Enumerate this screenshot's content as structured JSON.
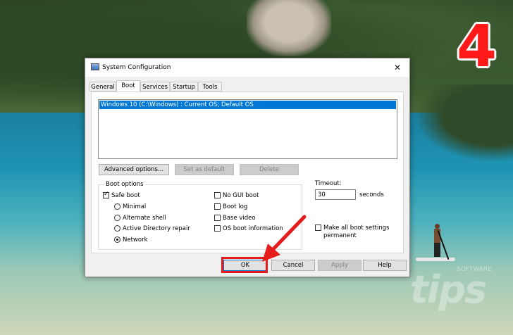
{
  "dialog": {
    "title": "System Configuration",
    "close_glyph": "✕",
    "tabs": [
      {
        "label": "General"
      },
      {
        "label": "Boot"
      },
      {
        "label": "Services"
      },
      {
        "label": "Startup"
      },
      {
        "label": "Tools"
      }
    ],
    "active_tab": "Boot",
    "os_entries": [
      "Windows 10 (C:\\Windows) : Current OS; Default OS"
    ],
    "buttons": {
      "advanced": "Advanced options...",
      "set_default": "Set as default",
      "delete": "Delete"
    },
    "boot_options": {
      "label": "Boot options",
      "safe_boot": {
        "label": "Safe boot",
        "checked": true
      },
      "minimal": {
        "label": "Minimal",
        "selected": false
      },
      "alternate_shell": {
        "label": "Alternate shell",
        "selected": false
      },
      "ad_repair": {
        "label": "Active Directory repair",
        "selected": false
      },
      "network": {
        "label": "Network",
        "selected": true
      },
      "no_gui_boot": {
        "label": "No GUI boot",
        "checked": false
      },
      "boot_log": {
        "label": "Boot log",
        "checked": false
      },
      "base_video": {
        "label": "Base video",
        "checked": false
      },
      "os_boot_info": {
        "label": "OS boot information",
        "checked": false
      }
    },
    "timeout": {
      "label": "Timeout:",
      "value": "30",
      "unit": "seconds"
    },
    "make_permanent": {
      "label_line1": "Make all boot settings",
      "label_line2": "permanent",
      "checked": false
    },
    "footer": {
      "ok": "OK",
      "cancel": "Cancel",
      "apply": "Apply",
      "help": "Help"
    }
  },
  "annotation": {
    "step_number": "4",
    "highlight_color": "#e61b1b"
  },
  "watermark": {
    "text": "tips",
    "small_text": "SOFTWARE"
  }
}
